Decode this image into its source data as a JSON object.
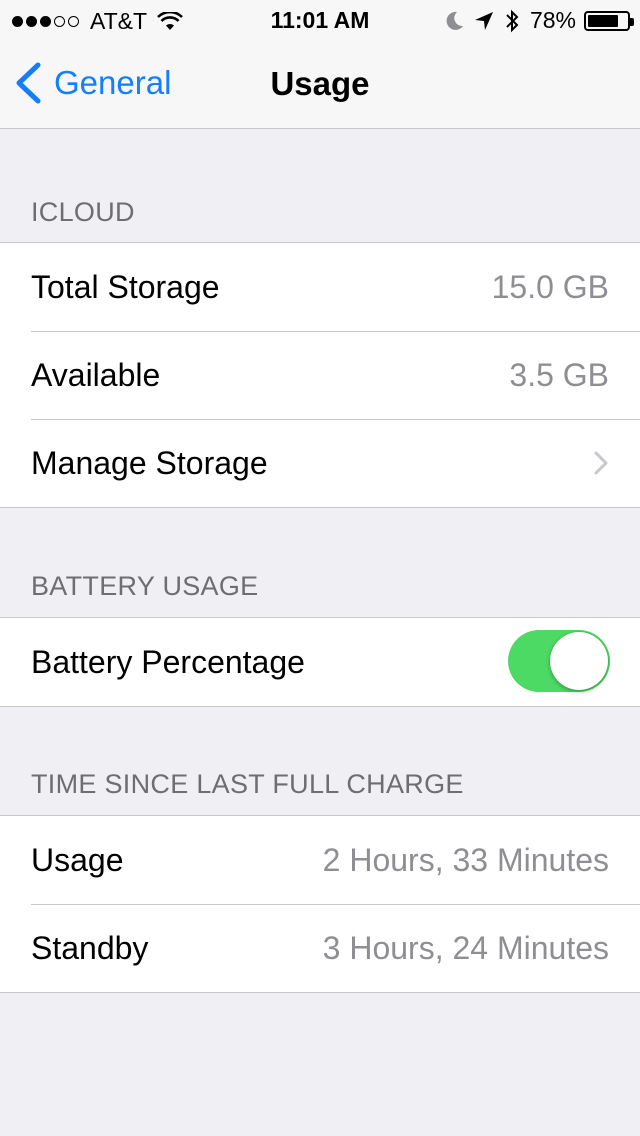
{
  "status_bar": {
    "carrier": "AT&T",
    "signal_bars_filled": 3,
    "signal_bars_total": 5,
    "time": "11:01 AM",
    "battery_percent": "78%",
    "battery_level": 0.78,
    "icons": [
      "wifi-icon",
      "moon-icon",
      "location-arrow-icon",
      "bluetooth-icon",
      "battery-icon"
    ]
  },
  "nav": {
    "back_label": "General",
    "title": "Usage"
  },
  "sections": {
    "icloud": {
      "header": "ICLOUD",
      "total_storage_label": "Total Storage",
      "total_storage_value": "15.0 GB",
      "available_label": "Available",
      "available_value": "3.5 GB",
      "manage_storage_label": "Manage Storage"
    },
    "battery_usage": {
      "header": "BATTERY USAGE",
      "battery_percentage_label": "Battery Percentage",
      "battery_percentage_on": true
    },
    "time_since_charge": {
      "header": "TIME SINCE LAST FULL CHARGE",
      "usage_label": "Usage",
      "usage_value": "2 Hours, 33 Minutes",
      "standby_label": "Standby",
      "standby_value": "3 Hours, 24 Minutes"
    }
  },
  "colors": {
    "accent": "#157efb",
    "toggle_on": "#4cd964",
    "background": "#efeff4",
    "secondary_text": "#8e8e93"
  }
}
